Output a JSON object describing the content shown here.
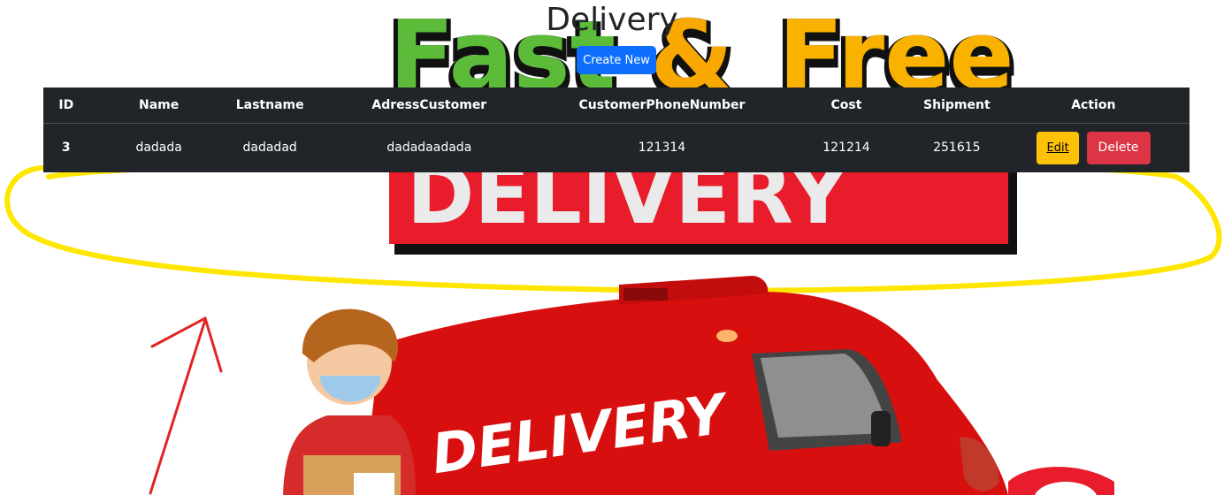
{
  "page": {
    "title": "Delivery",
    "create_button": "Create New"
  },
  "table": {
    "headers": [
      "ID",
      "Name",
      "Lastname",
      "AdressCustomer",
      "CustomerPhoneNumber",
      "Cost",
      "Shipment",
      "Action"
    ],
    "rows": [
      {
        "id": "3",
        "name": "dadada",
        "lastname": "dadadad",
        "address": "dadadaadada",
        "phone": "121314",
        "cost": "121214",
        "shipment": "251615",
        "edit_label": "Edit",
        "delete_label": "Delete"
      }
    ]
  },
  "background": {
    "banner_words": [
      "Fast",
      "&",
      "Free"
    ],
    "banner_main": "DELIVERY",
    "van_text": "DELIVERY"
  },
  "colors": {
    "primary": "#0d6efd",
    "warning": "#ffc107",
    "danger": "#dc3545",
    "table_dark": "#212529",
    "highlight": "#ffe600"
  }
}
